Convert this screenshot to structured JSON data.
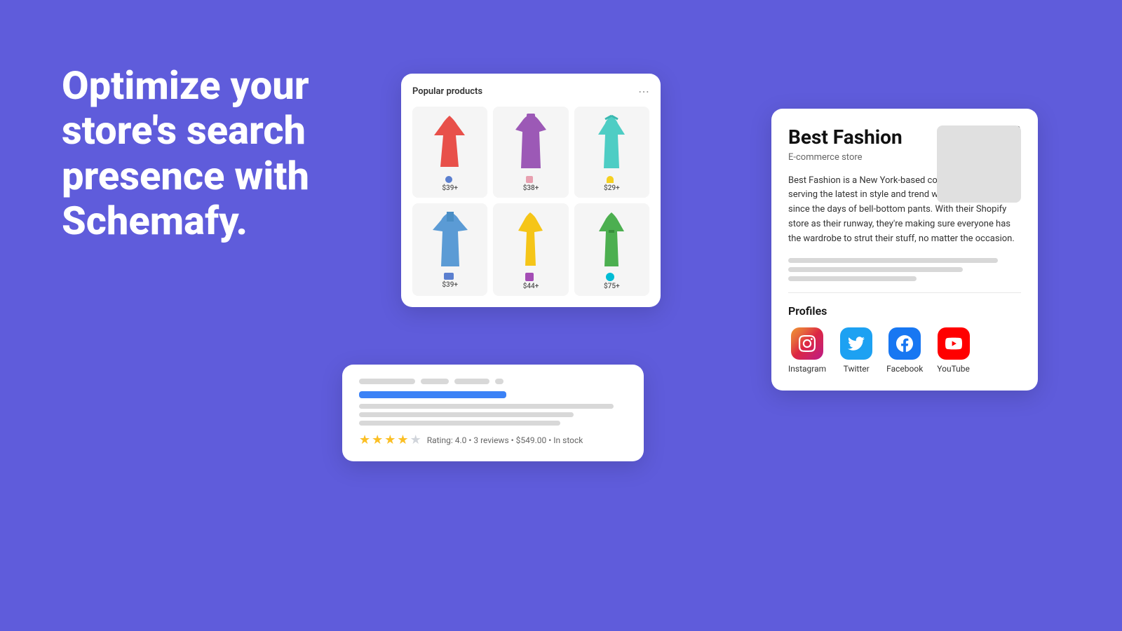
{
  "hero": {
    "text": "Optimize your store's search presence with Schemafy."
  },
  "popular_products": {
    "title": "Popular products",
    "products": [
      {
        "price": "$39+",
        "color": "red"
      },
      {
        "price": "$38+",
        "color": "purple"
      },
      {
        "price": "$29+",
        "color": "cyan"
      },
      {
        "price": "$39+",
        "color": "blue"
      },
      {
        "price": "$44+",
        "color": "yellow"
      },
      {
        "price": "$75+",
        "color": "green"
      }
    ]
  },
  "search_result": {
    "rating": "Rating: 4.0",
    "reviews": "3 reviews",
    "price": "$549.00",
    "stock": "In stock",
    "meta_text": "Rating: 4.0 • 3 reviews • $549.00 • In stock"
  },
  "business_card": {
    "name": "Best Fashion",
    "type": "E-commerce store",
    "description": "Best Fashion is a New York-based company that's been serving the latest in style and trend with a side of humor since the days of bell-bottom pants. With their Shopify store as their runway, they're making sure everyone has the wardrobe to strut their stuff, no matter the occasion.",
    "profiles_title": "Profiles",
    "profiles": [
      {
        "name": "Instagram",
        "type": "instagram"
      },
      {
        "name": "Twitter",
        "type": "twitter"
      },
      {
        "name": "Facebook",
        "type": "facebook"
      },
      {
        "name": "YouTube",
        "type": "youtube"
      }
    ]
  }
}
